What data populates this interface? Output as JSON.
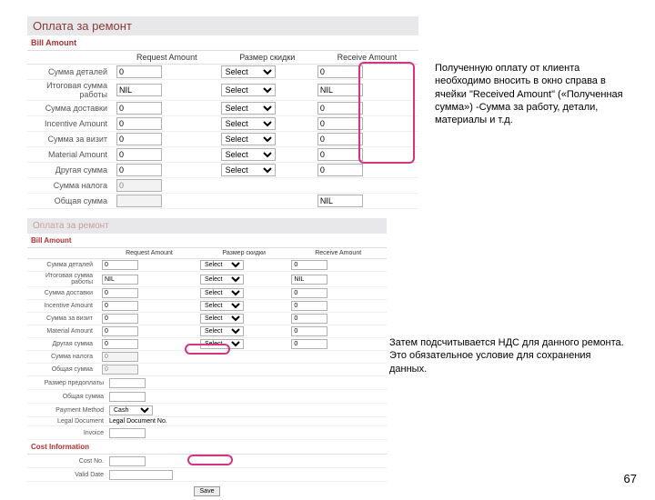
{
  "panel1": {
    "title": "Оплата за ремонт",
    "section": "Bill Amount",
    "headers": {
      "request": "Request Amount",
      "discount": "Размер скидки",
      "received": "Receive Amount"
    },
    "rows": [
      {
        "label": "Сумма деталей",
        "req": "0",
        "sel": "Select",
        "recv": "0"
      },
      {
        "label": "Итоговая сумма работы",
        "req": "NIL",
        "sel": "Select",
        "recv": "NIL"
      },
      {
        "label": "Сумма доставки",
        "req": "0",
        "sel": "Select",
        "recv": "0"
      },
      {
        "label": "Incentive Amount",
        "req": "0",
        "sel": "Select",
        "recv": "0"
      },
      {
        "label": "Сумма за визит",
        "req": "0",
        "sel": "Select",
        "recv": "0"
      },
      {
        "label": "Material Amount",
        "req": "0",
        "sel": "Select",
        "recv": "0"
      },
      {
        "label": "Другая сумма",
        "req": "0",
        "sel": "Select",
        "recv": "0"
      },
      {
        "label": "Сумма налога",
        "req": "0",
        "sel": "",
        "recv": ""
      },
      {
        "label": "Общая сумма",
        "req": "",
        "sel": "",
        "recv": "NIL"
      }
    ]
  },
  "panel2": {
    "title": "Оплата за ремонт",
    "section": "Bill Amount",
    "headers": {
      "request": "Request Amount",
      "discount": "Размер скидки",
      "received": "Receive Amount"
    },
    "rows": [
      {
        "label": "Сумма деталей",
        "req": "0",
        "sel": "Select",
        "recv": "0"
      },
      {
        "label": "Итоговая сумма работы",
        "req": "NIL",
        "sel": "Select",
        "recv": "NIL"
      },
      {
        "label": "Сумма доставки",
        "req": "0",
        "sel": "Select",
        "recv": "0"
      },
      {
        "label": "Incentive Amount",
        "req": "0",
        "sel": "Select",
        "recv": "0"
      },
      {
        "label": "Сумма за визит",
        "req": "0",
        "sel": "Select",
        "recv": "0"
      },
      {
        "label": "Material Amount",
        "req": "0",
        "sel": "Select",
        "recv": "0"
      },
      {
        "label": "Другая сумма",
        "req": "0",
        "sel": "Select",
        "recv": "0"
      },
      {
        "label": "Сумма налога",
        "req": "0",
        "sel": "",
        "recv": ""
      },
      {
        "label": "Общая сумма",
        "req": "0",
        "sel": "",
        "recv": ""
      }
    ],
    "extra_rows": [
      {
        "label": "Размер предоплаты",
        "val": ""
      },
      {
        "label": "Общая сумма",
        "val": ""
      }
    ],
    "payment": {
      "label": "Payment Method",
      "value": "Cash"
    },
    "legal": {
      "label": "Legal Document",
      "value": "Legal Document No."
    },
    "invoice": {
      "label": "Invoice",
      "value": ""
    },
    "cost_section": "Cost Information",
    "cost_no": {
      "label": "Cost No.",
      "value": ""
    },
    "valid": {
      "label": "Valid Date"
    },
    "save_btn": "Save"
  },
  "note1": "Полученную оплату от клиента необходимо вносить в окно справа в ячейки \"Received Amount\" («Полученная сумма») -Сумма за работу, детали, материалы и т.д.",
  "note2": "Затем подсчитывается НДС для данного ремонта. Это обязательное условие для сохранения данных.",
  "page": "67"
}
